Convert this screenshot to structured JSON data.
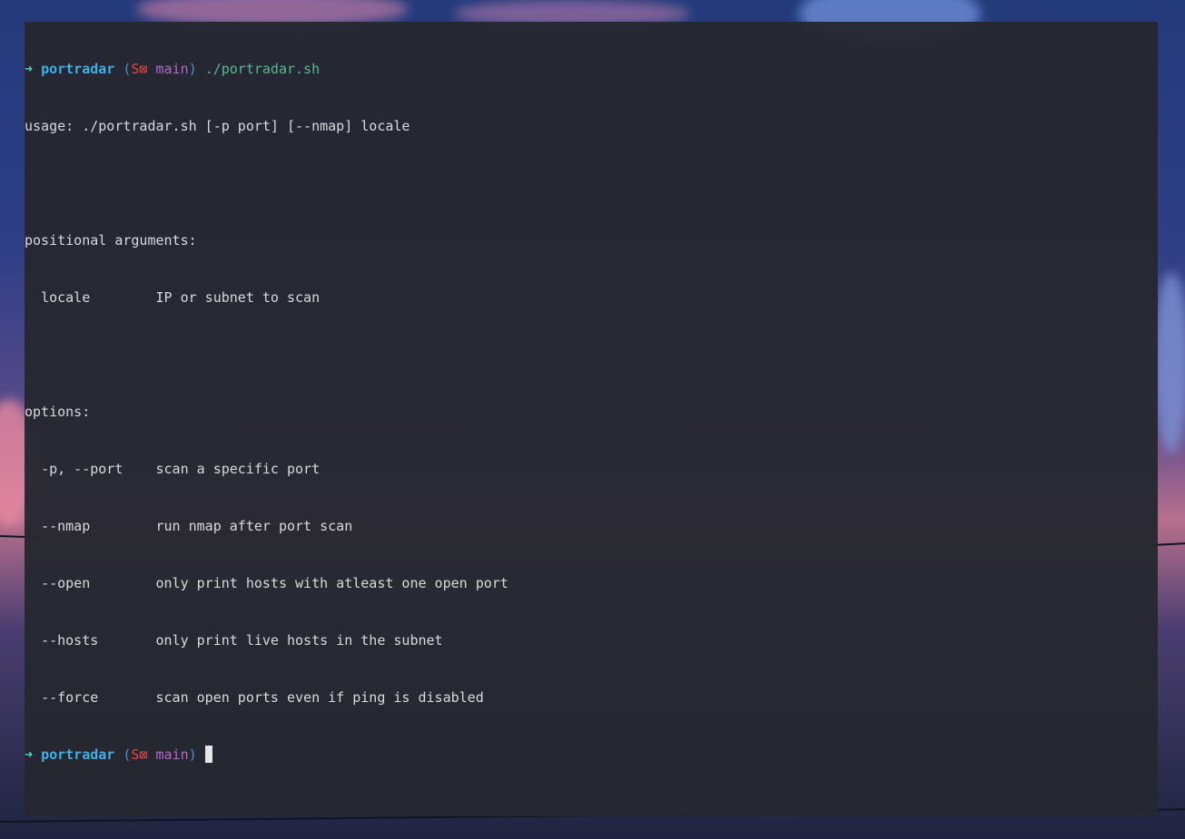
{
  "prompt": {
    "arrow": "➜",
    "directory": "portradar",
    "git_open": "(",
    "git_symbol": "S⊠",
    "branch": "main",
    "git_close": ")"
  },
  "command": "./portradar.sh",
  "output": {
    "usage": "usage: ./portradar.sh [-p port] [--nmap] locale",
    "positional_header": "positional arguments:",
    "positional": [
      {
        "flag": "locale",
        "desc": "IP or subnet to scan"
      }
    ],
    "options_header": "options:",
    "options": [
      {
        "flag": "-p, --port",
        "desc": "scan a specific port"
      },
      {
        "flag": "--nmap",
        "desc": "run nmap after port scan"
      },
      {
        "flag": "--open",
        "desc": "only print hosts with atleast one open port"
      },
      {
        "flag": "--hosts",
        "desc": "only print live hosts in the subnet"
      },
      {
        "flag": "--force",
        "desc": "scan open ports even if ping is disabled"
      }
    ]
  },
  "colors": {
    "terminal_bg": "#252830",
    "arrow": "#4fd0c8",
    "directory": "#3fb0e8",
    "paren": "#4a8ed8",
    "git_symbol": "#e0483c",
    "branch": "#b468c8",
    "command": "#57b98f",
    "text": "#d8dae0"
  }
}
